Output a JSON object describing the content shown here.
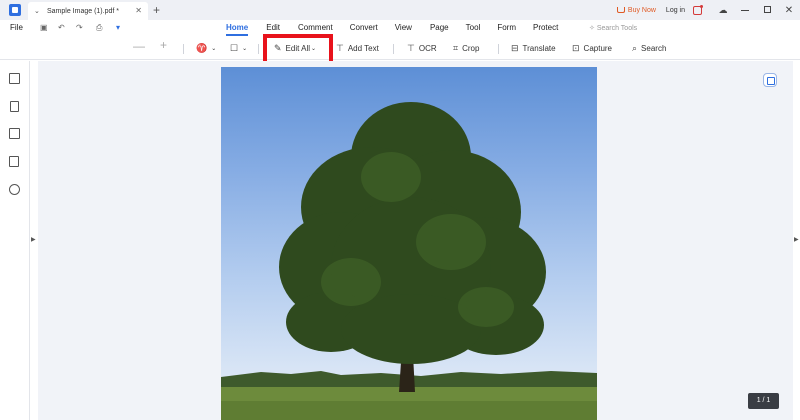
{
  "titlebar": {
    "tab_title": "Sample Image (1).pdf *",
    "buy_now": "Buy Now",
    "log_in": "Log in"
  },
  "menu": {
    "file": "File",
    "tabs": [
      "Home",
      "Edit",
      "Comment",
      "Convert",
      "View",
      "Page",
      "Tool",
      "Form",
      "Protect"
    ],
    "active_tab": "Home",
    "search_tools": "Search Tools"
  },
  "toolbar": {
    "edit_all": "Edit All",
    "add_text": "Add Text",
    "ocr": "OCR",
    "crop": "Crop",
    "translate": "Translate",
    "capture": "Capture",
    "search": "Search"
  },
  "status": {
    "page_counter": "1 / 1"
  },
  "colors": {
    "accent": "#2f6fe0",
    "highlight": "#e8121b",
    "buy_now": "#e05a24"
  },
  "icons": {
    "app": "app-logo-icon",
    "sidebar": [
      "book-icon",
      "bookmark-icon",
      "comment-icon",
      "attachment-icon",
      "search-icon"
    ]
  }
}
